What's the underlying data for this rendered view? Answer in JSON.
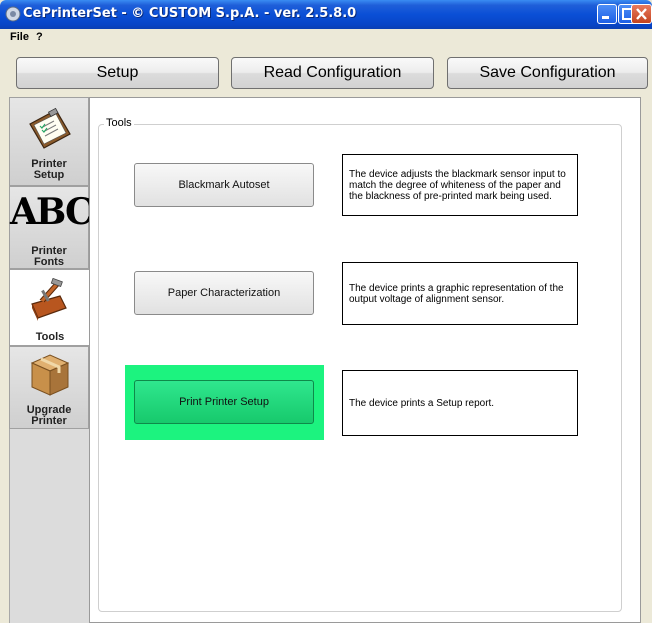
{
  "window": {
    "title": "CePrinterSet - © CUSTOM S.p.A. - ver. 2.5.8.0"
  },
  "menu": {
    "file": "File",
    "help": "?"
  },
  "toolbar": {
    "setup": "Setup",
    "read": "Read Configuration",
    "save": "Save Configuration"
  },
  "sidebar": {
    "items": [
      {
        "label_line1": "Printer",
        "label_line2": "Setup",
        "icon": "clipboard-icon"
      },
      {
        "label_line1": "Printer",
        "label_line2": "Fonts",
        "icon": "abc-font-icon",
        "glyph": "ABC"
      },
      {
        "label_line1": "Tools",
        "label_line2": "",
        "icon": "toolbox-icon",
        "selected": true
      },
      {
        "label_line1": "Upgrade",
        "label_line2": "Printer",
        "icon": "box-icon"
      }
    ]
  },
  "tools": {
    "group_title": "Tools",
    "actions": [
      {
        "label": "Blackmark Autoset",
        "description": "The device adjusts the blackmark sensor input to match the degree of whiteness of the paper and the blackness of pre-printed mark being used."
      },
      {
        "label": "Paper Characterization",
        "description": "The device prints a graphic representation of the output voltage of alignment sensor."
      },
      {
        "label": "Print Printer Setup",
        "description": "The device prints a Setup report.",
        "highlighted": true
      }
    ]
  },
  "colors": {
    "title_bar": "#0a4fd6",
    "highlight": "#1cf37f"
  }
}
